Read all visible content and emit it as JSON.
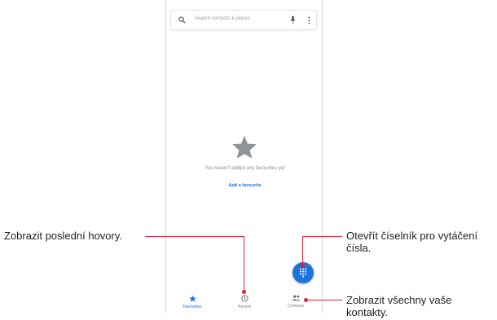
{
  "search": {
    "placeholder": "Search contacts & places"
  },
  "empty_state": {
    "message": "You haven't added any favourites yet",
    "link": "Add a favourite"
  },
  "nav": {
    "items": [
      {
        "label": "Favourites",
        "icon": "star-icon",
        "active": true
      },
      {
        "label": "Recent",
        "icon": "clock-icon",
        "active": false
      },
      {
        "label": "Contacts",
        "icon": "people-icon",
        "active": false
      }
    ]
  },
  "fab": {
    "icon": "dialpad-icon",
    "color": "#1e74d8"
  },
  "callouts": {
    "recent": "Zobrazit poslední hovory.",
    "dialpad_line1": "Otevřít číselník pro vytáčení",
    "dialpad_line2": "čísla.",
    "contacts_line1": "Zobrazit všechny vaše",
    "contacts_line2": "kontakty."
  },
  "colors": {
    "accent": "#1a73e8",
    "callout_line": "#e0203b"
  }
}
